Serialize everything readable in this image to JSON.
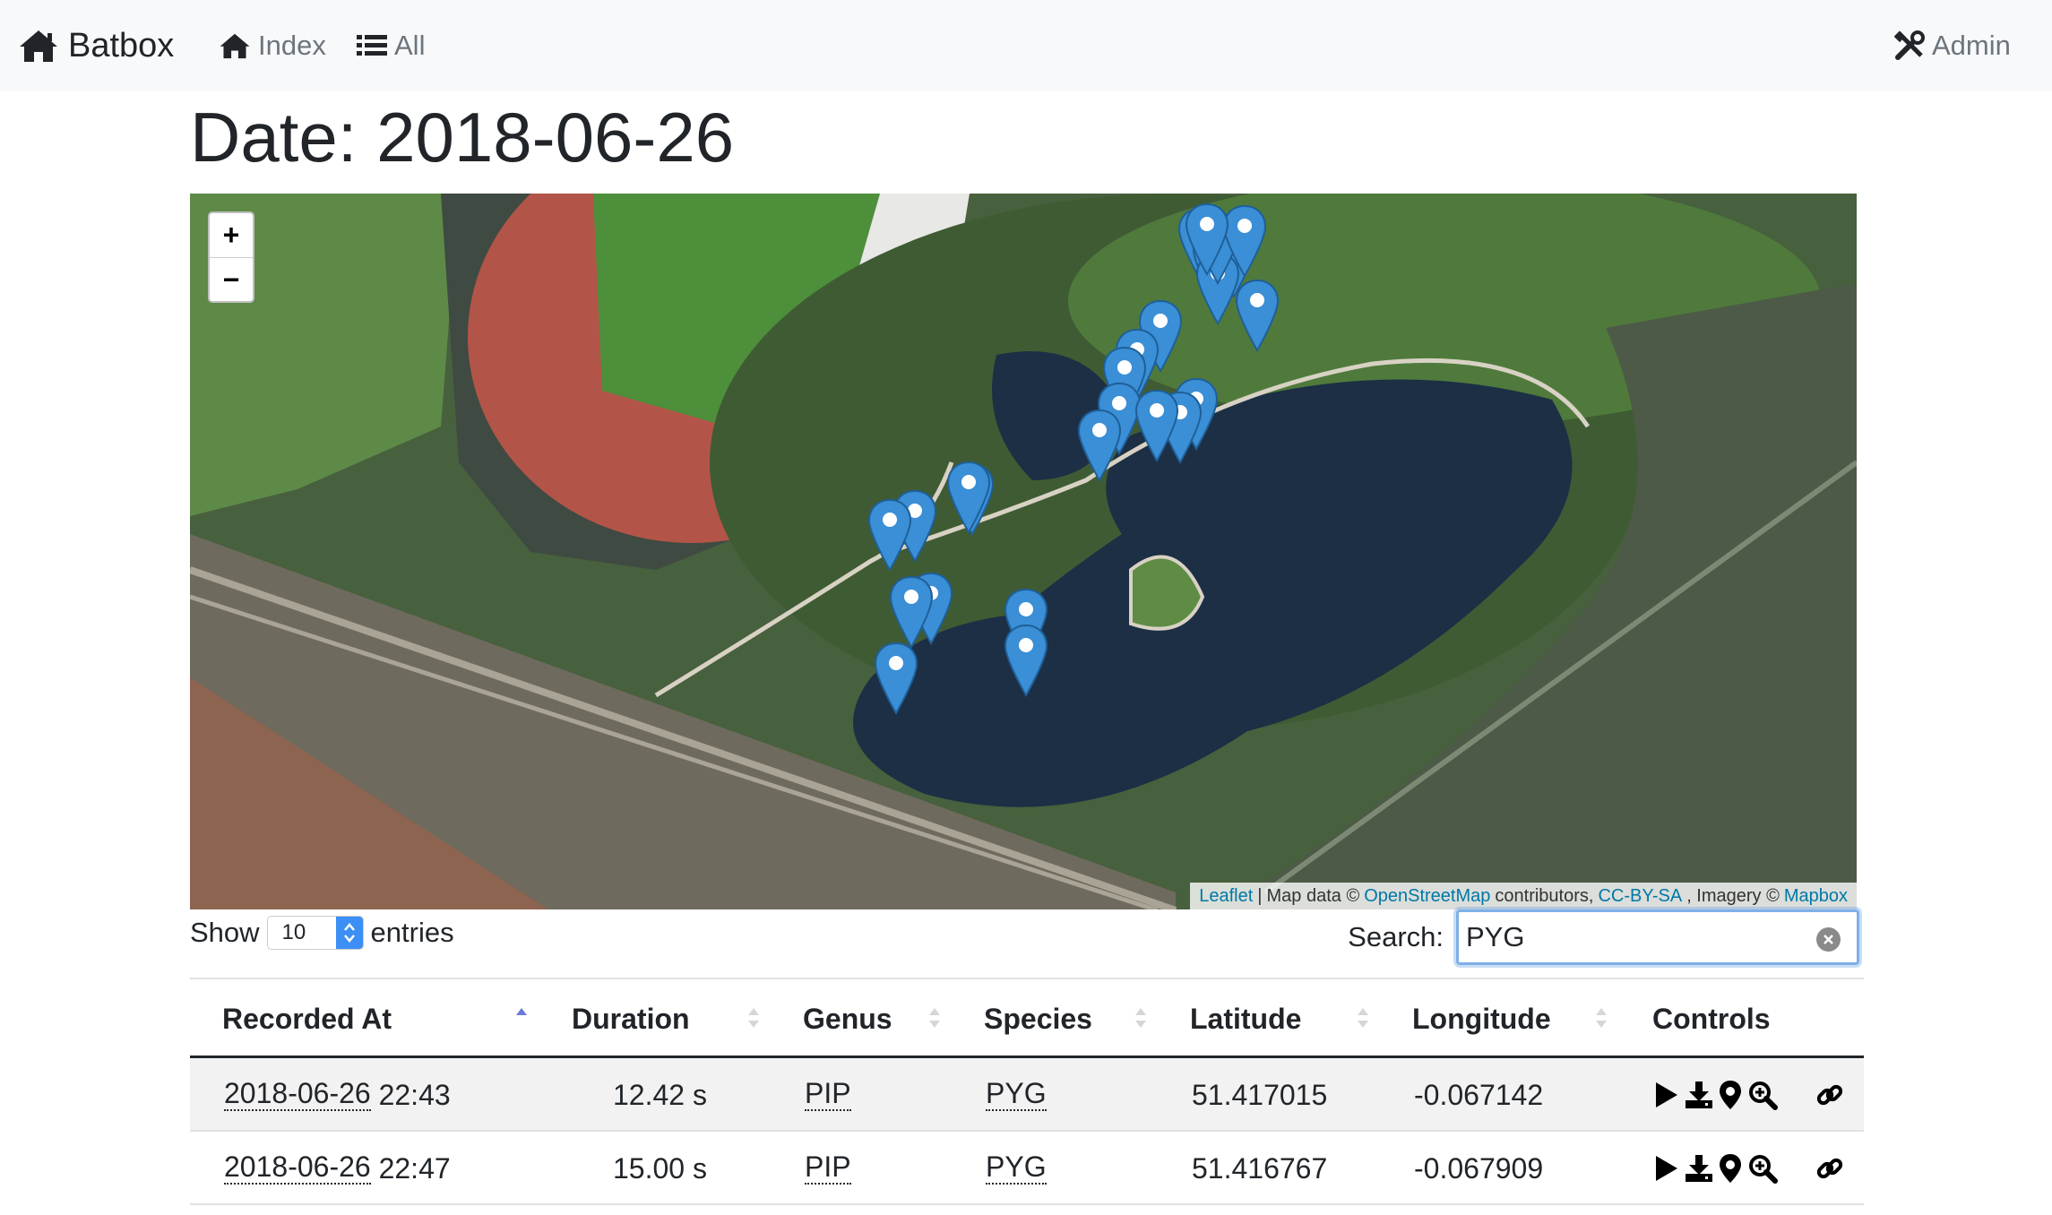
{
  "navbar": {
    "brand": "Batbox",
    "links": [
      {
        "label": "Index",
        "icon": "home-icon"
      },
      {
        "label": "All",
        "icon": "list-icon"
      }
    ],
    "admin": {
      "label": "Admin",
      "icon": "tools-icon"
    }
  },
  "page": {
    "title": "Date: 2018-06-26"
  },
  "map": {
    "zoom_in": "+",
    "zoom_out": "−",
    "attribution": {
      "leaflet": "Leaflet",
      "sep": "|",
      "map_data": "Map data ©",
      "osm": "OpenStreetMap",
      "contributors": "contributors,",
      "license": "CC-BY-SA",
      "imagery": ", Imagery ©",
      "mapbox": "Mapbox"
    },
    "marker_color": "#3a8fd6",
    "marker_count": 25
  },
  "table_controls": {
    "show_label": "Show",
    "page_size": "10",
    "entries_label": "entries",
    "search_label": "Search:",
    "search_value": "PYG"
  },
  "table": {
    "columns": [
      "Recorded At",
      "Duration",
      "Genus",
      "Species",
      "Latitude",
      "Longitude",
      "Controls"
    ],
    "sorted_column": "Recorded At",
    "sort_direction": "ascending",
    "rows": [
      {
        "date": "2018-06-26",
        "time": "22:43",
        "duration": "12.42 s",
        "genus": "PIP",
        "species": "PYG",
        "latitude": "51.417015",
        "longitude": "-0.067142"
      },
      {
        "date": "2018-06-26",
        "time": "22:47",
        "duration": "15.00 s",
        "genus": "PIP",
        "species": "PYG",
        "latitude": "51.416767",
        "longitude": "-0.067909"
      }
    ],
    "control_icons": [
      "play-icon",
      "download-icon",
      "map-marker-icon",
      "zoom-icon",
      "link-icon"
    ]
  }
}
